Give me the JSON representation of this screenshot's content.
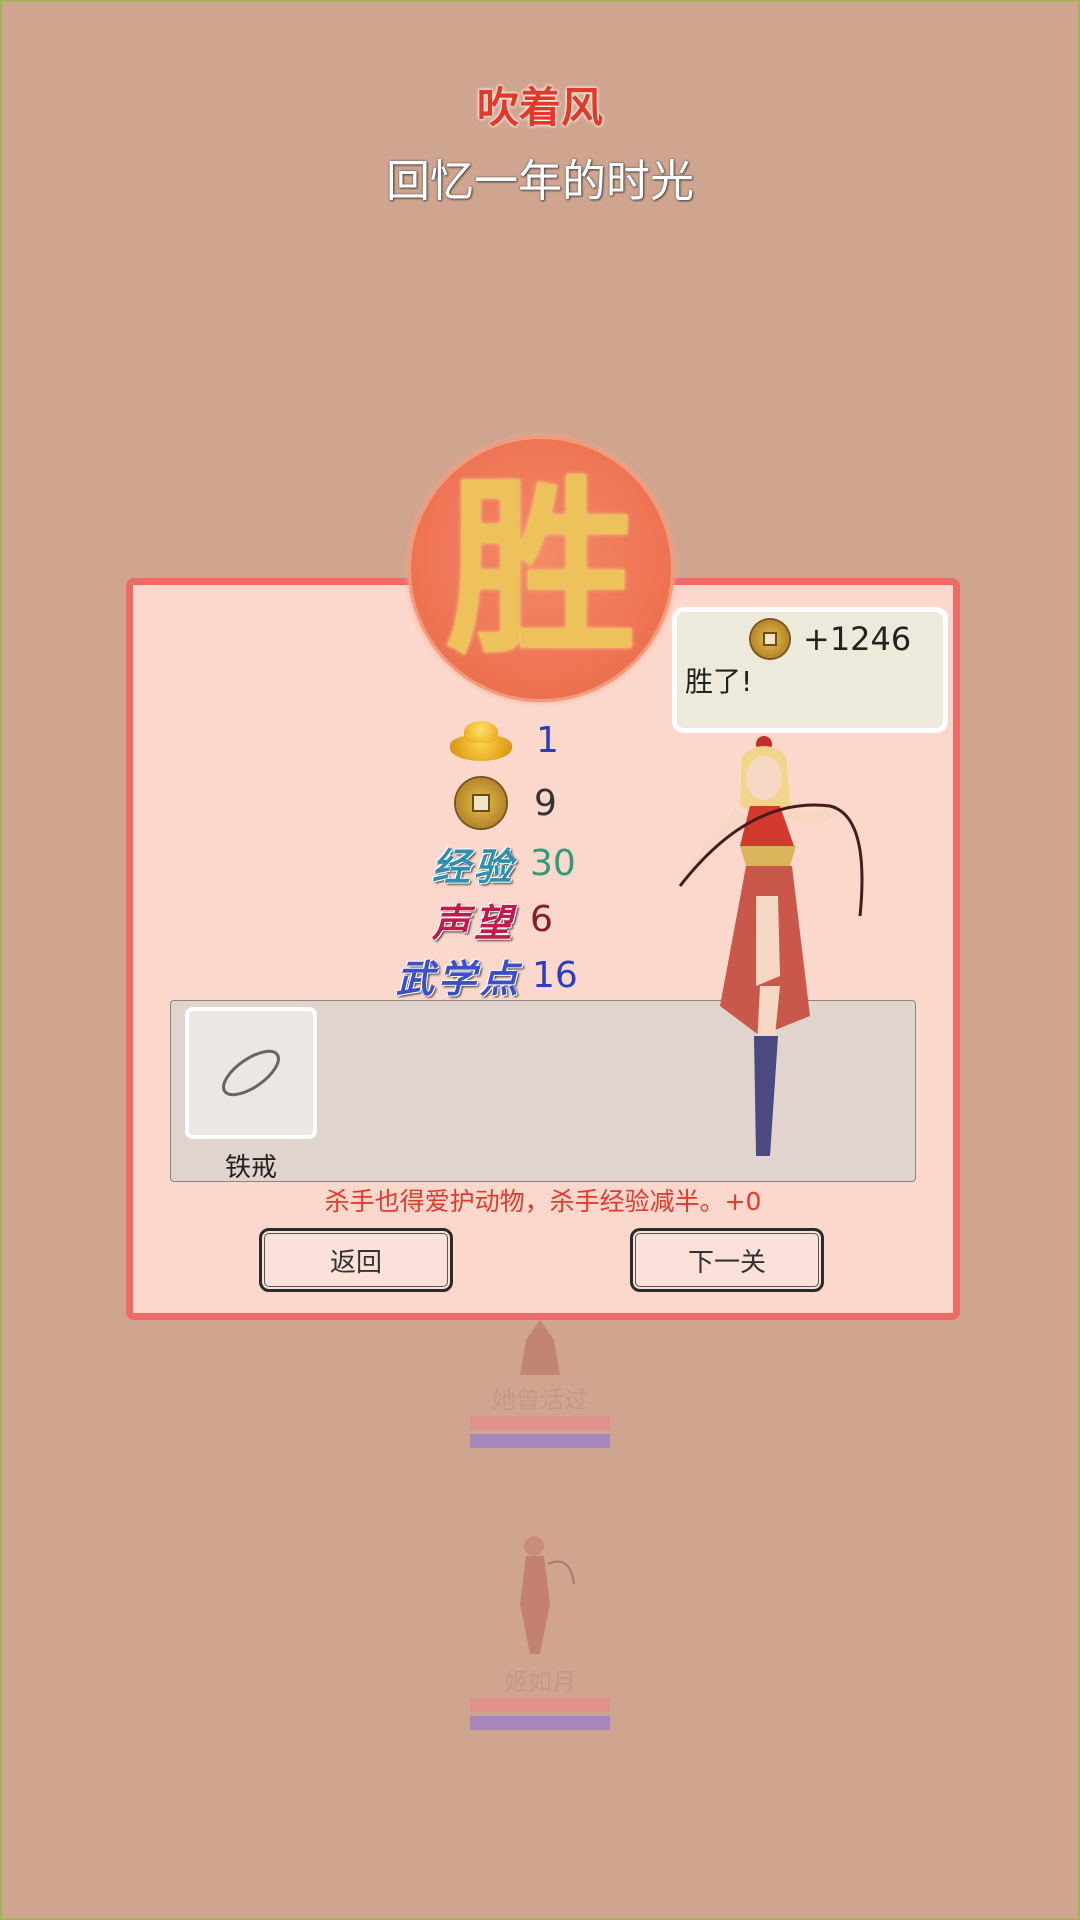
{
  "header": {
    "title": "吹着风",
    "subtitle": "回忆一年的时光"
  },
  "background_characters": [
    {
      "name": "她曾活过"
    },
    {
      "name": "姬如月"
    }
  ],
  "result": {
    "seal_char": "胜",
    "bubble": {
      "gain": "+1246",
      "message": "胜了!"
    },
    "rewards": {
      "gold_ingot": "1",
      "coins": "9",
      "exp_label": "经验",
      "exp": "30",
      "fame_label": "声望",
      "fame": "6",
      "martial_label": "武学点",
      "martial": "16"
    },
    "items": [
      {
        "name": "铁戒",
        "icon": "ring-icon"
      }
    ],
    "note": "杀手也得爱护动物，杀手经验减半。+0",
    "back_label": "返回",
    "next_label": "下一关"
  },
  "colors": {
    "background": "#d0a58f",
    "panel": "#fbd7cc",
    "panel_border": "#ef6a67",
    "seal": "#ee7454",
    "exp": "#2f9c7a",
    "fame": "#8b1a2a",
    "martial": "#2a3ec0"
  }
}
